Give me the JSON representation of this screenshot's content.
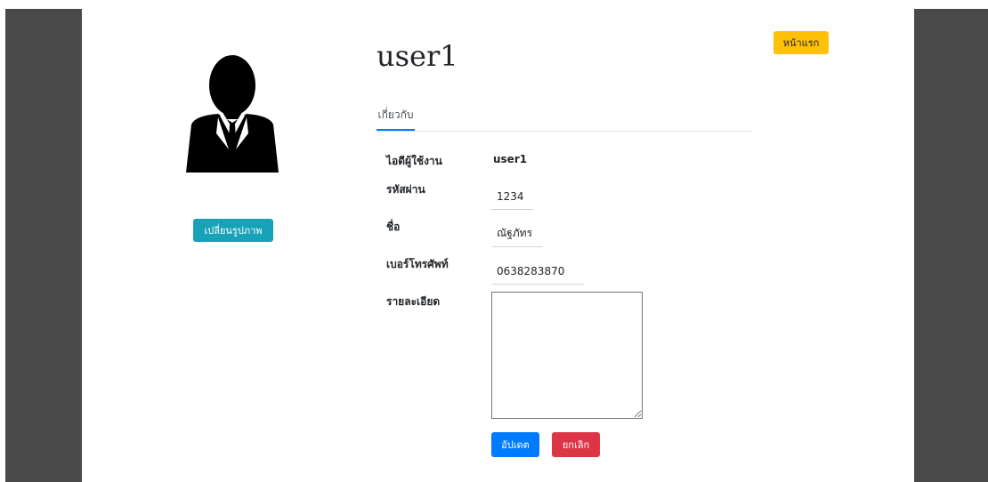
{
  "header": {
    "home_button_label": "หน้าแรก"
  },
  "profile": {
    "avatar_icon": "user-silhouette-icon",
    "change_picture_label": "เปลี่ยนรูปภาพ",
    "title": "user1"
  },
  "tabs": [
    {
      "label": "เกี่ยวกับ",
      "active": true
    }
  ],
  "form": {
    "username_label": "ไอดีผู้ใช้งาน",
    "username_value": "user1",
    "password_label": "รหัสผ่าน",
    "password_value": "1234",
    "name_label": "ชื่อ",
    "name_value": "ณัฐภัทร",
    "phone_label": "เบอร์โทรศัพท์",
    "phone_value": "0638283870",
    "details_label": "รายละเอียด",
    "details_value": "",
    "update_label": "อัปเดต",
    "cancel_label": "ยกเลิก"
  },
  "colors": {
    "sidebar": "#4a4a4a",
    "info": "#17a2b8",
    "warning": "#ffc107",
    "primary": "#007bff",
    "danger": "#dc3545"
  }
}
